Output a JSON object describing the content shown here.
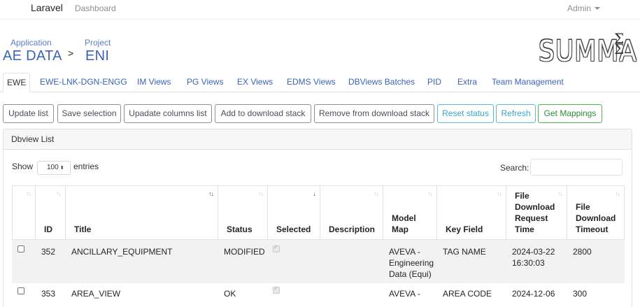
{
  "navbar": {
    "brand": "Laravel",
    "dashboard": "Dashboard",
    "user": "Admin"
  },
  "header": {
    "app_label": "Application",
    "app_value": "AE DATA",
    "separator": ">",
    "project_label": "Project",
    "project_value": "ENI",
    "logo_text": "SUMMA",
    "logo_symbol": "Σ Σ"
  },
  "tabs": [
    "EWE",
    "EWE-LNK-DGN-ENGG",
    "IM Views",
    "PG Views",
    "EX Views",
    "EDMS Views",
    "DBViews Batches",
    "PID",
    "Extra",
    "Team Management"
  ],
  "toolbar": [
    "Update list",
    "Save selection",
    "Upadate columns list",
    "Add to download stack",
    "Remove from download stack",
    "Reset status",
    "Refresh",
    "Get Mappings"
  ],
  "card": {
    "title": "Dbview List",
    "show_label": "Show",
    "entries_value": "100",
    "entries_label": "entries",
    "search_label": "Search:"
  },
  "table": {
    "columns": [
      "",
      "ID",
      "Title",
      "Status",
      "Selected",
      "Description",
      "Model Map",
      "Key Field",
      "File Download Request Time",
      "File Download Timeout"
    ],
    "rows": [
      {
        "id": "352",
        "title": "ANCILLARY_EQUIPMENT",
        "status": "MODIFIED",
        "description": "",
        "model_map": "AVEVA - Engineering Data (Equi)",
        "key_field": "TAG NAME",
        "request_time": "2024-03-22 16:30:03",
        "timeout": "2800"
      },
      {
        "id": "353",
        "title": "AREA_VIEW",
        "status": "OK",
        "description": "",
        "model_map": "AVEVA -",
        "key_field": "AREA CODE",
        "request_time": "2024-12-06",
        "timeout": "300"
      }
    ]
  }
}
